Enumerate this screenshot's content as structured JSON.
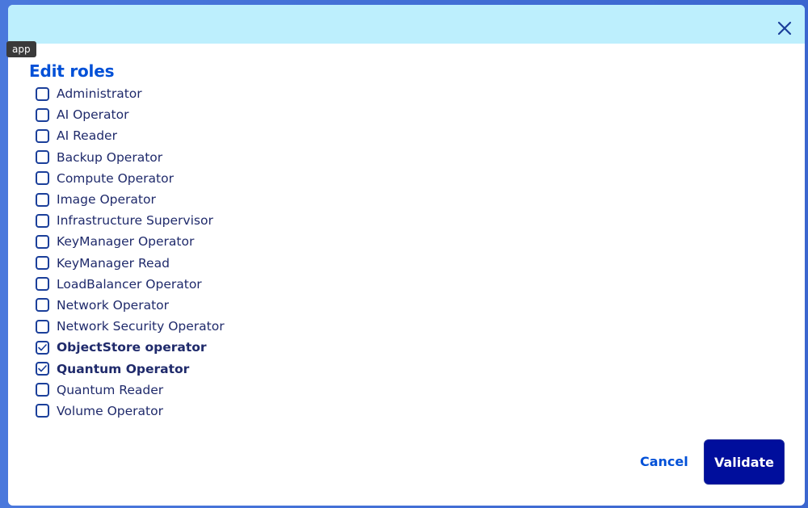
{
  "tooltip": {
    "text": "app"
  },
  "dialog": {
    "title": "Edit roles",
    "roles": [
      {
        "label": "Administrator",
        "checked": false
      },
      {
        "label": "AI Operator",
        "checked": false
      },
      {
        "label": "AI Reader",
        "checked": false
      },
      {
        "label": "Backup Operator",
        "checked": false
      },
      {
        "label": "Compute Operator",
        "checked": false
      },
      {
        "label": "Image Operator",
        "checked": false
      },
      {
        "label": "Infrastructure Supervisor",
        "checked": false
      },
      {
        "label": "KeyManager Operator",
        "checked": false
      },
      {
        "label": "KeyManager Read",
        "checked": false
      },
      {
        "label": "LoadBalancer Operator",
        "checked": false
      },
      {
        "label": "Network Operator",
        "checked": false
      },
      {
        "label": "Network Security Operator",
        "checked": false
      },
      {
        "label": "ObjectStore operator",
        "checked": true
      },
      {
        "label": "Quantum Operator",
        "checked": true
      },
      {
        "label": "Quantum Reader",
        "checked": false
      },
      {
        "label": "Volume Operator",
        "checked": false
      }
    ],
    "cancel_label": "Cancel",
    "validate_label": "Validate"
  },
  "icons": {
    "close": "close-icon",
    "check": "check-icon"
  },
  "colors": {
    "header": "#bdeffd",
    "accent": "#0050d7",
    "primary_button": "#000e9c",
    "text": "#1f2a6b"
  }
}
